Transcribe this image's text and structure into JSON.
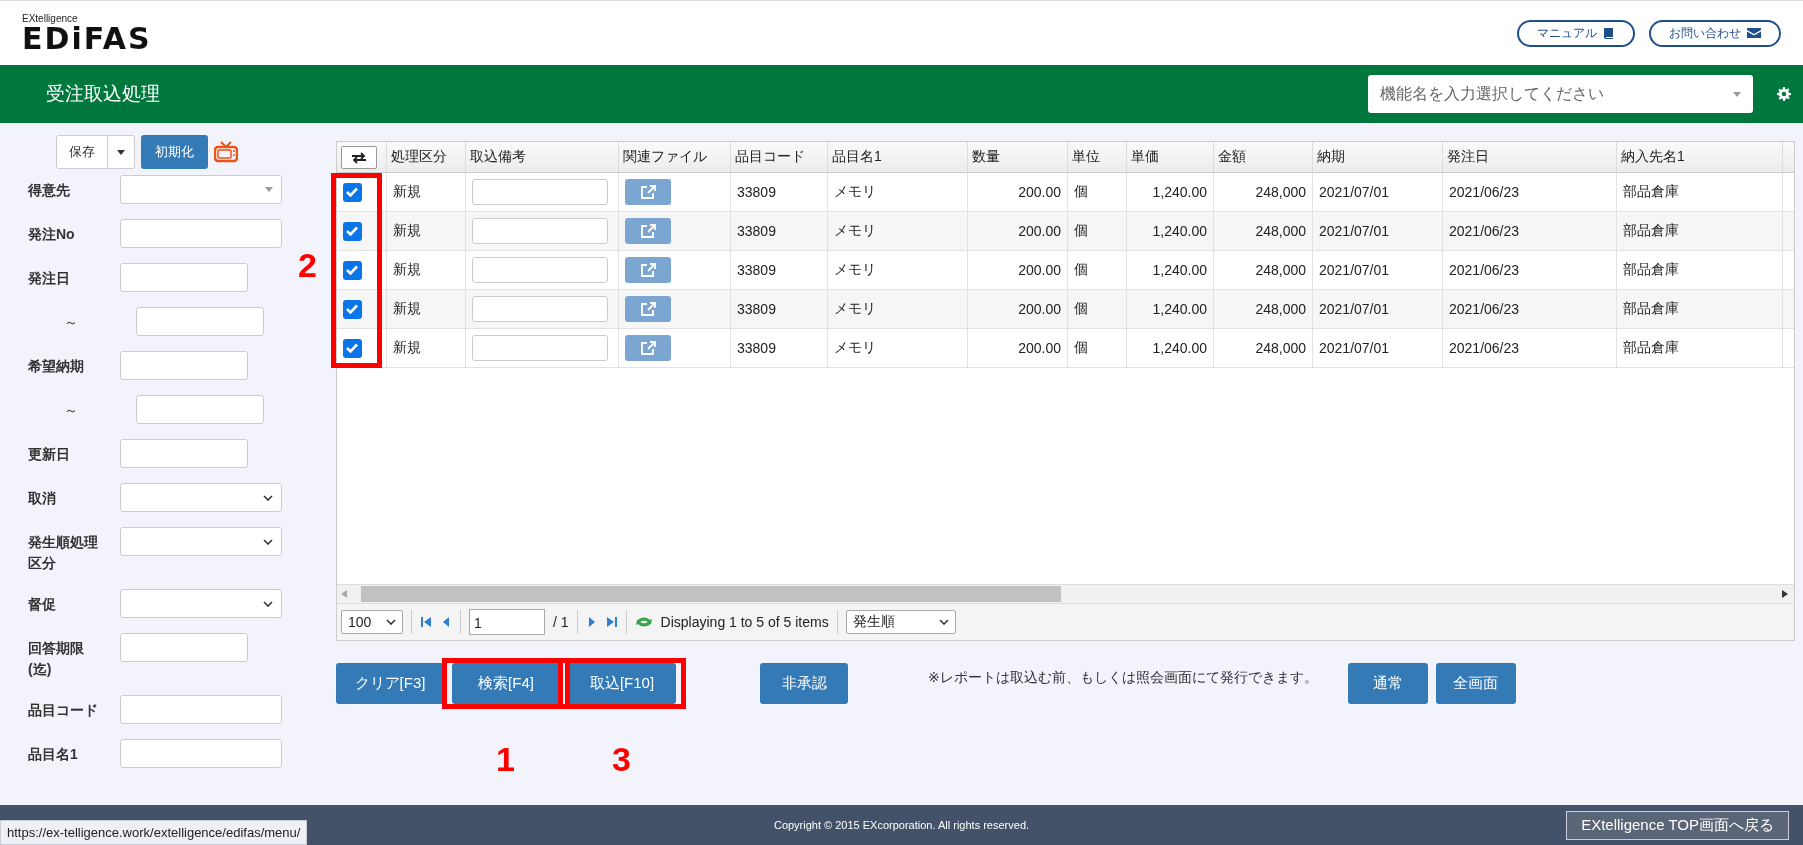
{
  "header": {
    "brand_small": "EXtelligence",
    "brand": "EDiFAS",
    "links": [
      {
        "label": "マニュアル"
      },
      {
        "label": "お問い合わせ"
      }
    ]
  },
  "titlebar": {
    "title": "受注取込処理",
    "function_select": {
      "placeholder": "機能名を入力選択してください"
    }
  },
  "sidebar": {
    "save_button": "保存",
    "reset_button": "初期化",
    "fields": [
      {
        "label": "得意先",
        "kind": "combo"
      },
      {
        "label": "発注No",
        "kind": "text"
      },
      {
        "label": "発注日",
        "kind": "date"
      },
      {
        "label": "～",
        "kind": "date"
      },
      {
        "label": "希望納期",
        "kind": "date"
      },
      {
        "label": "～",
        "kind": "date"
      },
      {
        "label": "更新日",
        "kind": "date"
      },
      {
        "label": "取消",
        "kind": "select"
      },
      {
        "label": "発生順処理区分",
        "kind": "select"
      },
      {
        "label": "督促",
        "kind": "select"
      },
      {
        "label": "回答期限(迄)",
        "kind": "date"
      },
      {
        "label": "品目コード",
        "kind": "text"
      },
      {
        "label": "品目名1",
        "kind": "text"
      }
    ]
  },
  "table": {
    "annotation": "2",
    "columns": [
      {
        "kind": "check"
      },
      {
        "label": "処理区分",
        "kind": "text"
      },
      {
        "label": "取込備考",
        "kind": "input"
      },
      {
        "label": "関連ファイル",
        "kind": "file"
      },
      {
        "label": "品目コード",
        "kind": "text"
      },
      {
        "label": "品目名1",
        "kind": "text"
      },
      {
        "label": "数量",
        "kind": "num"
      },
      {
        "label": "単位",
        "kind": "text"
      },
      {
        "label": "単価",
        "kind": "num"
      },
      {
        "label": "金額",
        "kind": "num"
      },
      {
        "label": "納期",
        "kind": "text"
      },
      {
        "label": "発注日",
        "kind": "text"
      },
      {
        "label": "納入先名1",
        "kind": "text"
      }
    ],
    "rows": [
      {
        "checked": true,
        "cells": [
          "",
          "新規",
          "",
          "",
          "33809",
          "メモリ",
          "200.00",
          "個",
          "1,240.00",
          "248,000",
          "2021/07/01",
          "2021/06/23",
          "部品倉庫"
        ]
      },
      {
        "checked": true,
        "cells": [
          "",
          "新規",
          "",
          "",
          "33809",
          "メモリ",
          "200.00",
          "個",
          "1,240.00",
          "248,000",
          "2021/07/01",
          "2021/06/23",
          "部品倉庫"
        ]
      },
      {
        "checked": true,
        "cells": [
          "",
          "新規",
          "",
          "",
          "33809",
          "メモリ",
          "200.00",
          "個",
          "1,240.00",
          "248,000",
          "2021/07/01",
          "2021/06/23",
          "部品倉庫"
        ]
      },
      {
        "checked": true,
        "cells": [
          "",
          "新規",
          "",
          "",
          "33809",
          "メモリ",
          "200.00",
          "個",
          "1,240.00",
          "248,000",
          "2021/07/01",
          "2021/06/23",
          "部品倉庫"
        ]
      },
      {
        "checked": true,
        "cells": [
          "",
          "新規",
          "",
          "",
          "33809",
          "メモリ",
          "200.00",
          "個",
          "1,240.00",
          "248,000",
          "2021/07/01",
          "2021/06/23",
          "部品倉庫"
        ]
      }
    ]
  },
  "pager": {
    "page_size": "100",
    "page": "1",
    "total": "/ 1",
    "info": "Displaying 1 to 5 of 5 items",
    "sort": "発生順"
  },
  "actions": {
    "buttons": [
      {
        "label": "クリア[F3]",
        "kind": "main"
      },
      {
        "label": "検索[F4]",
        "kind": "main",
        "annotation": "1"
      },
      {
        "label": "取込[F10]",
        "kind": "main",
        "annotation": "3"
      },
      {
        "label": "非承認",
        "kind": "approve"
      },
      {
        "label": "通常",
        "kind": "view"
      },
      {
        "label": "全画面",
        "kind": "view"
      }
    ],
    "note": "※レポートは取込む前、もしくは照会画面にて発行できます。"
  },
  "footer": {
    "copyright": "Copyright © 2015 EXcorporation. All rights reserved.",
    "top_button": "EXtelligence TOP画面へ戻る",
    "url_tooltip": "https://ex-telligence.work/extelligence/edifas/menu/"
  }
}
